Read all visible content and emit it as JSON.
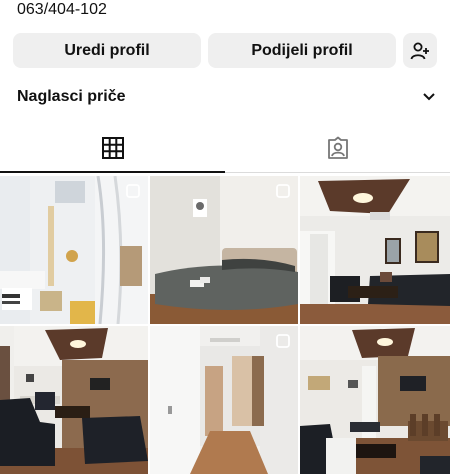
{
  "profile": {
    "phone": "063/404-102"
  },
  "buttons": {
    "edit": "Uredi profil",
    "share": "Podijeli profil",
    "add_icon": "add-person-icon"
  },
  "highlights": {
    "label": "Naglasci priče",
    "icon": "chevron-down-icon"
  },
  "tabs": [
    {
      "name": "posts-grid",
      "icon": "grid-icon",
      "active": true
    },
    {
      "name": "tagged",
      "icon": "tagged-person-icon",
      "active": false
    }
  ],
  "posts": [
    {
      "subject": "bathroom",
      "multi": true
    },
    {
      "subject": "bedroom",
      "multi": true
    },
    {
      "subject": "living-room",
      "multi": false
    },
    {
      "subject": "living-room-tv",
      "multi": false
    },
    {
      "subject": "hallway",
      "multi": true
    },
    {
      "subject": "living-room-dining",
      "multi": false
    }
  ],
  "colors": {
    "button_bg": "#efefef",
    "text": "#111111",
    "divider": "#dbdbdb"
  }
}
